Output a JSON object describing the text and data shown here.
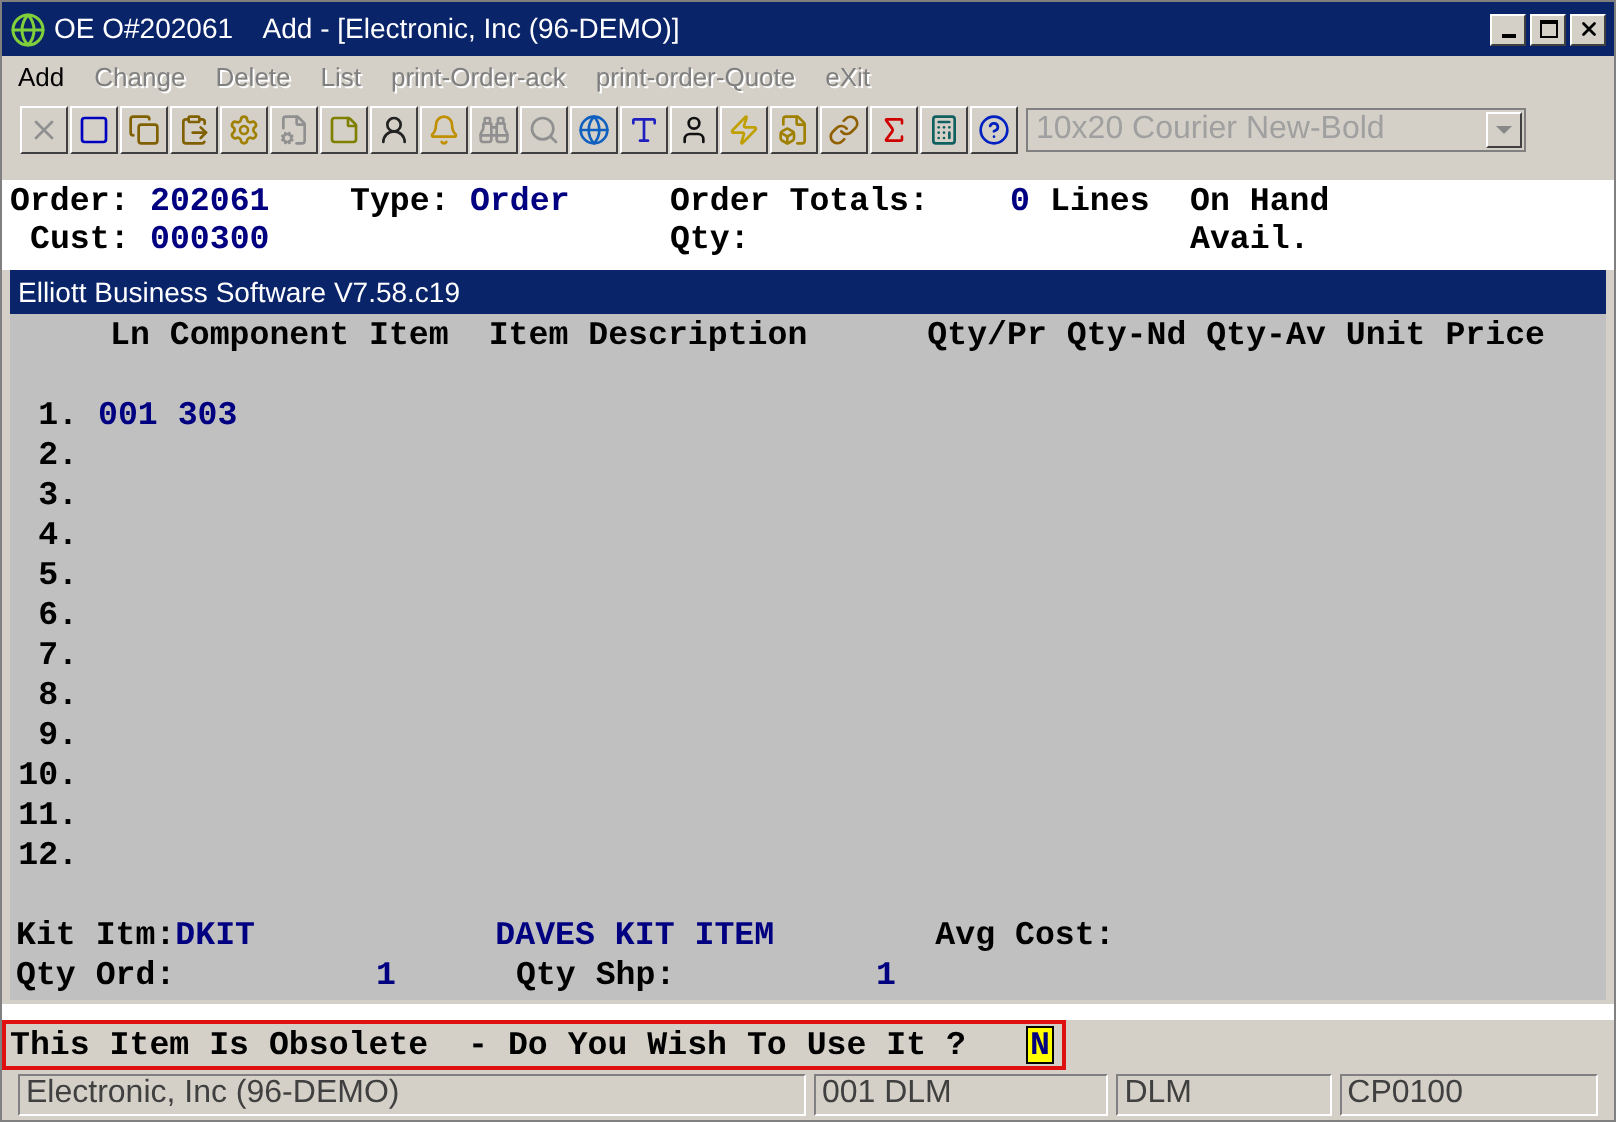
{
  "window": {
    "title": "OE O#202061    Add - [Electronic, Inc (96-DEMO)]"
  },
  "menu": [
    {
      "label": "Add",
      "disabled": false
    },
    {
      "label": "Change",
      "disabled": true
    },
    {
      "label": "Delete",
      "disabled": true
    },
    {
      "label": "List",
      "disabled": true
    },
    {
      "label": "print-Order-ack",
      "disabled": true
    },
    {
      "label": "print-order-Quote",
      "disabled": true
    },
    {
      "label": "eXit",
      "disabled": true
    }
  ],
  "toolbar": [
    {
      "kind": "cancel",
      "disabled": true
    },
    {
      "kind": "select",
      "disabled": false
    },
    {
      "kind": "copy",
      "disabled": false
    },
    {
      "kind": "paste",
      "disabled": false
    },
    {
      "kind": "gear",
      "disabled": false
    },
    {
      "kind": "properties",
      "disabled": true
    },
    {
      "kind": "note",
      "disabled": false
    },
    {
      "kind": "user",
      "disabled": false
    },
    {
      "kind": "bell",
      "disabled": false
    },
    {
      "kind": "binoculars",
      "disabled": true
    },
    {
      "kind": "search",
      "disabled": true
    },
    {
      "kind": "globe",
      "disabled": false
    },
    {
      "kind": "font",
      "disabled": false
    },
    {
      "kind": "person",
      "disabled": false
    },
    {
      "kind": "bolt",
      "disabled": false
    },
    {
      "kind": "bolt-doc",
      "disabled": false
    },
    {
      "kind": "link",
      "disabled": false
    },
    {
      "kind": "function",
      "disabled": false
    },
    {
      "kind": "calculator",
      "disabled": false
    },
    {
      "kind": "help",
      "disabled": false
    }
  ],
  "font_select": {
    "value": "10x20 Courier New-Bold",
    "disabled": true
  },
  "header": {
    "order_label": "Order:",
    "order": "202061",
    "type_label": "Type:",
    "type": "Order",
    "totals_label": "Order Totals:",
    "lines_count": "0",
    "lines_label": "Lines",
    "on_hand_label": "On Hand",
    "cust_label": "Cust:",
    "cust": "000300",
    "qty_label": "Qty:",
    "avail_label": "Avail."
  },
  "panel_title": "Elliott Business Software V7.58.c19",
  "table": {
    "columns": [
      "Ln",
      "Component Item",
      "Item Description",
      "Qty/Pr",
      "Qty-Nd",
      "Qty-Av",
      "Unit Price"
    ],
    "rows": [
      {
        "ln": "1.",
        "value": "001 303"
      },
      {
        "ln": "2."
      },
      {
        "ln": "3."
      },
      {
        "ln": "4."
      },
      {
        "ln": "5."
      },
      {
        "ln": "6."
      },
      {
        "ln": "7."
      },
      {
        "ln": "8."
      },
      {
        "ln": "9."
      },
      {
        "ln": "10."
      },
      {
        "ln": "11."
      },
      {
        "ln": "12."
      }
    ]
  },
  "kit": {
    "item_label": "Kit Itm:",
    "item": "DKIT",
    "description": "DAVES KIT ITEM",
    "avg_cost_label": "Avg Cost:",
    "qty_ord_label": "Qty Ord:",
    "qty_ord": "1",
    "qty_shp_label": "Qty Shp:",
    "qty_shp": "1"
  },
  "prompt": {
    "text": "This Item Is Obsolete  - Do You Wish To Use It ?",
    "answer": "N"
  },
  "status_bar": [
    "Electronic, Inc (96-DEMO)",
    "001 DLM",
    "DLM",
    "CP0100"
  ]
}
